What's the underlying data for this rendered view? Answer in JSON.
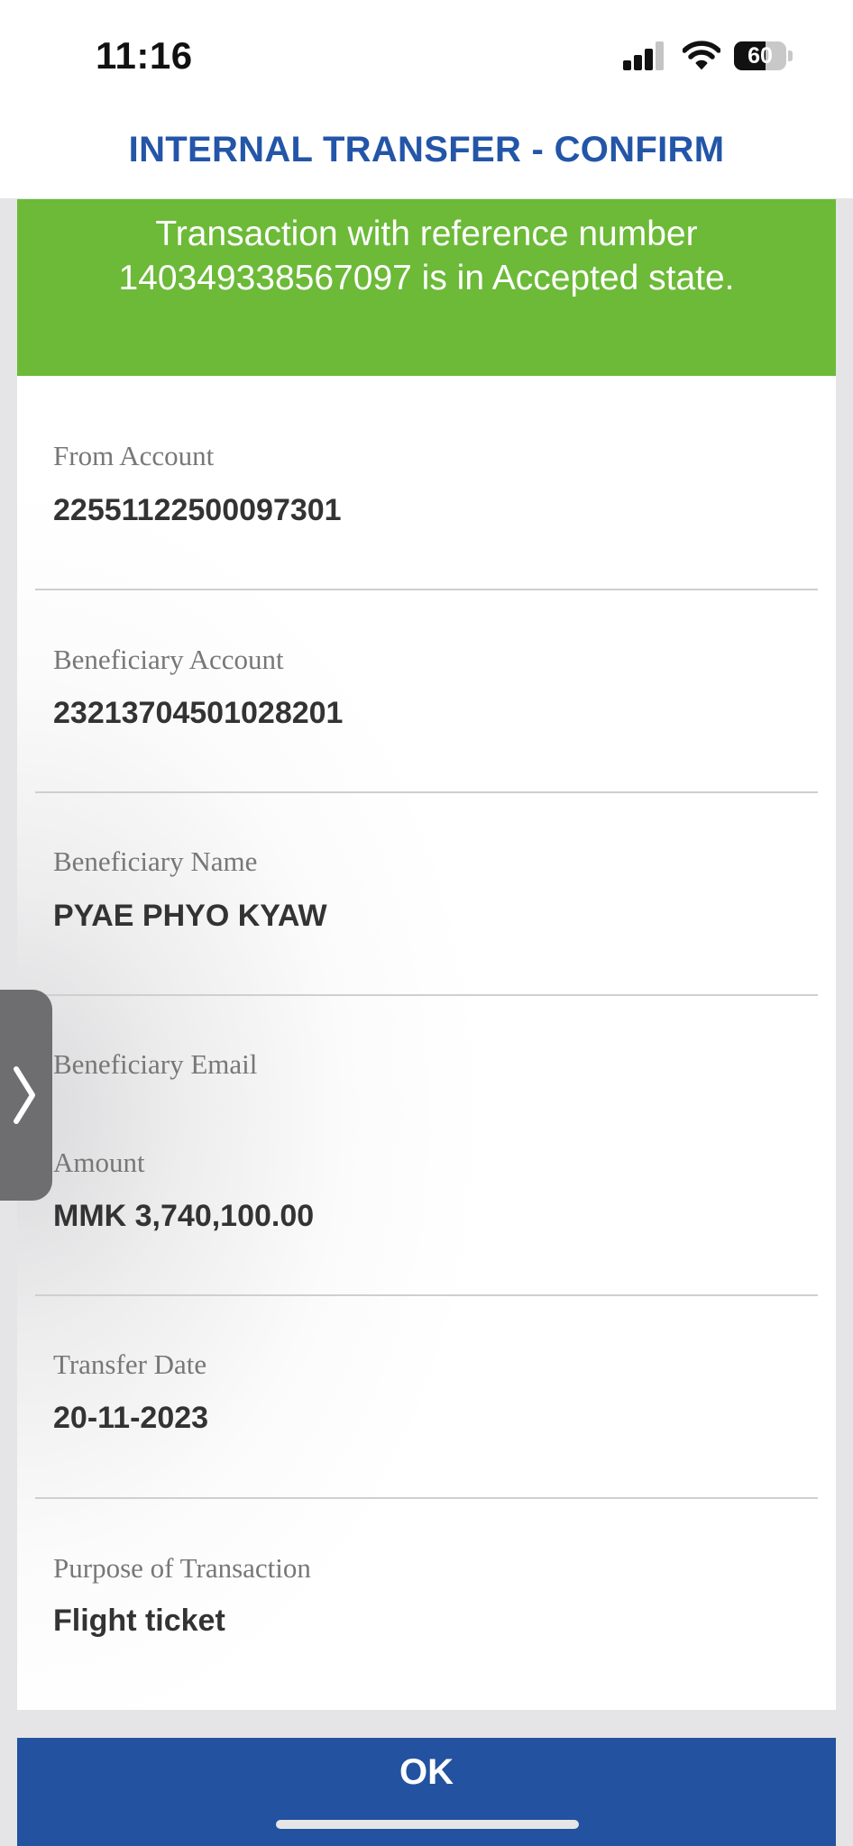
{
  "status_bar": {
    "time": "11:16",
    "battery_level": "60",
    "battery_fraction": 0.6
  },
  "header": {
    "title": "INTERNAL TRANSFER - CONFIRM"
  },
  "banner": {
    "message": "Transaction with reference  number\n140349338567097 is in Accepted state.",
    "color": "#6cba38"
  },
  "details": {
    "from_account": {
      "label": "From Account",
      "value": "22551122500097301"
    },
    "beneficiary_account": {
      "label": "Beneficiary Account",
      "value": "23213704501028201"
    },
    "beneficiary_name": {
      "label": "Beneficiary Name",
      "value": "PYAE PHYO KYAW"
    },
    "beneficiary_email": {
      "label": "Beneficiary Email",
      "value": ""
    },
    "amount": {
      "label": "Amount",
      "value": "MMK 3,740,100.00"
    },
    "transfer_date": {
      "label": "Transfer Date",
      "value": "20-11-2023"
    },
    "purpose": {
      "label": "Purpose of Transaction",
      "value": "Flight ticket"
    }
  },
  "side_handle": {
    "icon": "chevron-right-icon"
  },
  "actions": {
    "ok_label": "OK",
    "ok_color": "#2352a0"
  },
  "colors": {
    "title": "#2355a8",
    "accent": "#2352a0",
    "success": "#6cba38"
  }
}
